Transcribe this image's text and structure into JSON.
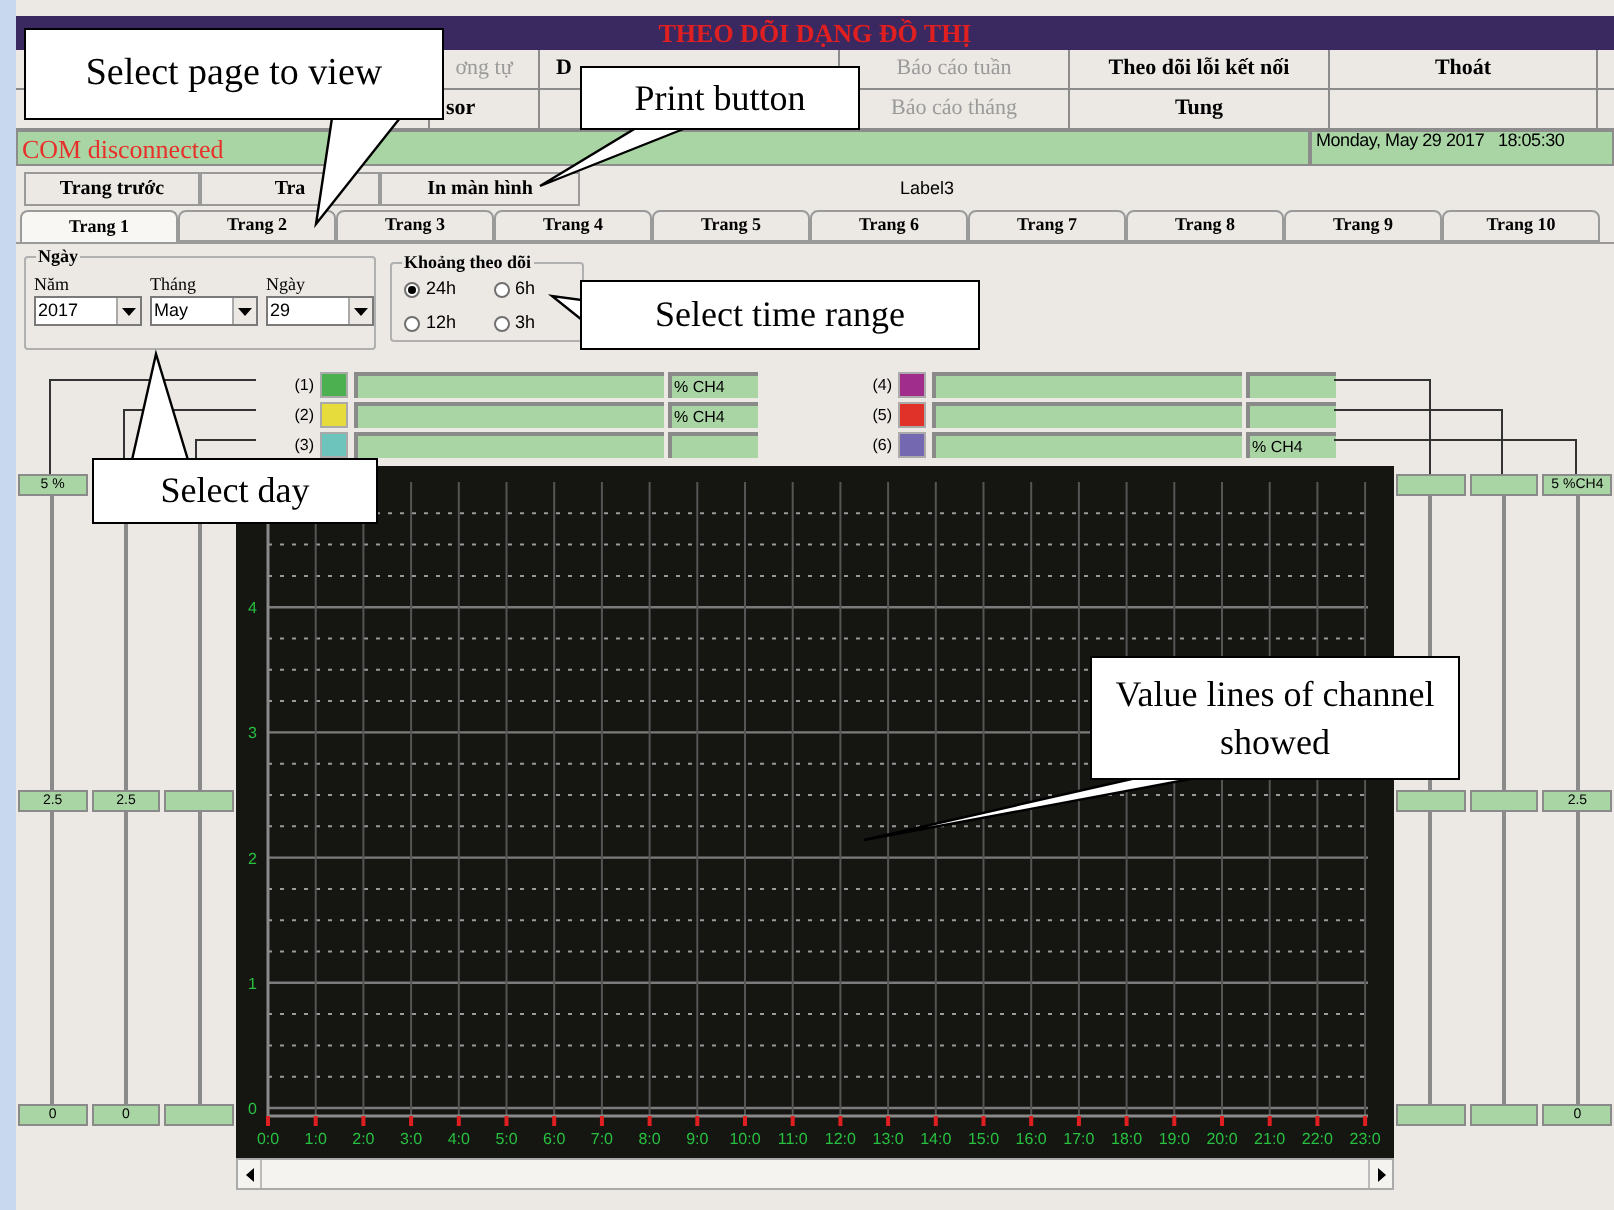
{
  "window": {
    "title": "THEO DÕI DẠNG ĐỒ THỊ"
  },
  "menu": [
    [
      {
        "label": "ơng tự",
        "disabled": true,
        "kind": "center"
      },
      {
        "label": "D",
        "disabled": false,
        "kind": "cut"
      },
      {
        "label": "Báo cáo tuần",
        "disabled": true,
        "kind": "center"
      },
      {
        "label": "Theo dõi lỗi kết nối",
        "disabled": false,
        "kind": "center"
      },
      {
        "label": "Thoát",
        "disabled": false,
        "kind": "center"
      }
    ],
    [
      {
        "label": "sor",
        "disabled": false,
        "kind": "cut"
      },
      {
        "kind": "center"
      },
      {
        "label": "Báo cáo tháng",
        "disabled": true,
        "kind": "center"
      },
      {
        "label": "Tung",
        "disabled": false,
        "kind": "center"
      },
      {
        "kind": "center"
      }
    ]
  ],
  "status": {
    "message": "COM disconnected",
    "datetime": "Monday, May 29 2017   18:05:30"
  },
  "buttons": [
    {
      "label": "Trang trước"
    },
    {
      "label": "Tra"
    },
    {
      "label": "In màn hình"
    }
  ],
  "label3": "Label3",
  "tabs": [
    {
      "label": "Trang 1",
      "selected": true
    },
    {
      "label": "Trang 2",
      "selected": false
    },
    {
      "label": "Trang 3",
      "selected": false
    },
    {
      "label": "Trang 4",
      "selected": false
    },
    {
      "label": "Trang 5",
      "selected": false
    },
    {
      "label": "Trang 6",
      "selected": false
    },
    {
      "label": "Trang 7",
      "selected": false
    },
    {
      "label": "Trang 8",
      "selected": false
    },
    {
      "label": "Trang 9",
      "selected": false
    },
    {
      "label": "Trang 10",
      "selected": false
    }
  ],
  "date_group": {
    "title": "Ngày",
    "fields": [
      {
        "label": "Năm",
        "value": "2017"
      },
      {
        "label": "Tháng",
        "value": "May"
      },
      {
        "label": "Ngày",
        "value": "29"
      }
    ]
  },
  "range_group": {
    "title": "Khoảng theo dõi",
    "options": [
      {
        "label": "24h",
        "selected": true
      },
      {
        "label": "6h",
        "selected": false
      },
      {
        "label": "12h",
        "selected": false
      },
      {
        "label": "3h",
        "selected": false
      }
    ]
  },
  "channels_left": [
    {
      "label": "(1)",
      "color": "#4caf50",
      "unit": "% CH4"
    },
    {
      "label": "(2)",
      "color": "#e6dc3c",
      "unit": "% CH4"
    },
    {
      "label": "(3)",
      "color": "#6cc4bc"
    }
  ],
  "channels_right": [
    {
      "label": "(4)",
      "color": "#a02c8c"
    },
    {
      "label": "(5)",
      "color": "#e03228"
    },
    {
      "label": "(6)",
      "color": "#7468b0",
      "unit": "% CH4"
    }
  ],
  "scales_left": [
    {
      "kind": "scale",
      "max": "5 %",
      "mid": "2.5",
      "min": "0"
    },
    {
      "kind": "scale",
      "mid": "2.5",
      "min": "0"
    },
    {
      "kind": "scale"
    }
  ],
  "scales_right": [
    {
      "kind": "scale"
    },
    {
      "kind": "scale"
    },
    {
      "kind": "scale",
      "max": "5 %CH4",
      "mid": "2.5",
      "min": "0"
    }
  ],
  "chart_data": {
    "type": "line",
    "grid": true,
    "ylim": [
      0,
      5
    ],
    "yticks": [
      0,
      1,
      2,
      3,
      4
    ],
    "categories": [
      "0:0",
      "1:0",
      "2:0",
      "3:0",
      "4:0",
      "5:0",
      "6:0",
      "7:0",
      "8:0",
      "9:0",
      "10:0",
      "11:0",
      "12:0",
      "13:0",
      "14:0",
      "15:0",
      "16:0",
      "17:0",
      "18:0",
      "19:0",
      "20:0",
      "21:0",
      "22:0",
      "23:0"
    ]
  },
  "callouts": [
    {
      "text": "Select page to view"
    },
    {
      "text": "Print button"
    },
    {
      "text": "Select time range"
    },
    {
      "text": "Select day"
    },
    {
      "text": "Value lines of channel showed"
    }
  ]
}
